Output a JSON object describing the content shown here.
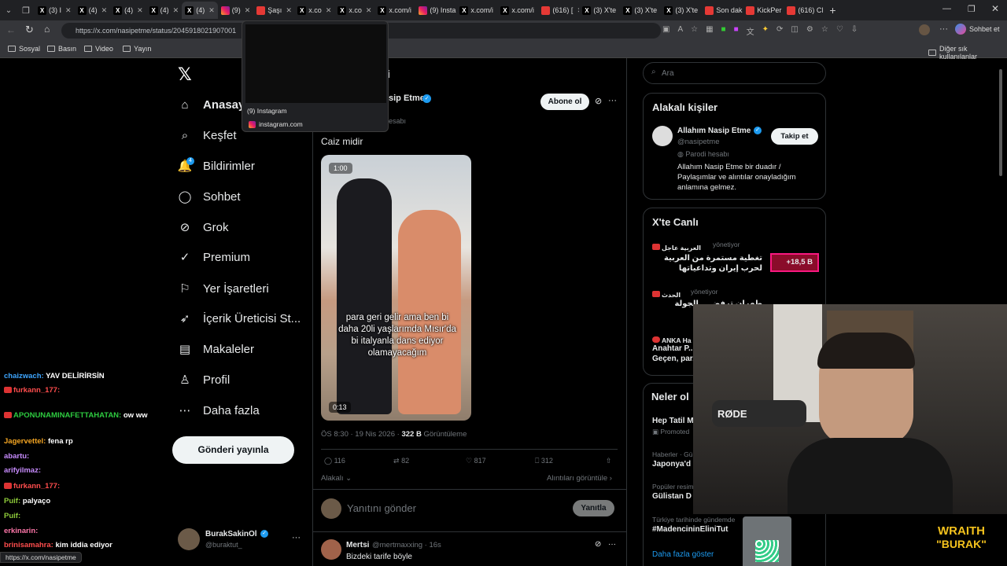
{
  "browser": {
    "tabs": [
      {
        "label": "(3) I",
        "fav": "x"
      },
      {
        "label": "(4)",
        "fav": "x"
      },
      {
        "label": "(4)",
        "fav": "x"
      },
      {
        "label": "(4)",
        "fav": "x"
      },
      {
        "label": "(4)",
        "fav": "x",
        "active": true
      },
      {
        "label": "(9)",
        "fav": "ig"
      },
      {
        "label": "Şaşı",
        "fav": "red"
      },
      {
        "label": "x.co",
        "fav": "x"
      },
      {
        "label": "x.co",
        "fav": "x"
      },
      {
        "label": "x.com/i",
        "fav": "x"
      },
      {
        "label": "(9) Insta",
        "fav": "ig"
      },
      {
        "label": "x.com/i",
        "fav": "x"
      },
      {
        "label": "x.com/i",
        "fav": "x"
      },
      {
        "label": "(616) [",
        "fav": "yt"
      },
      {
        "label": "(3) X'te",
        "fav": "x"
      },
      {
        "label": "(3) X'te",
        "fav": "x"
      },
      {
        "label": "(3) X'te",
        "fav": "x"
      },
      {
        "label": "Son dak",
        "fav": "red"
      },
      {
        "label": "KickPer",
        "fav": "red"
      },
      {
        "label": "(616) Cl",
        "fav": "yt"
      }
    ],
    "url": "https://x.com/nasipetme/status/2045918021907001",
    "chat_button": "Sohbet et",
    "bookmarks": [
      "Sosyal",
      "Basın",
      "Video",
      "Yayın"
    ],
    "bookmarks_right": "Diğer sık kullanılanlar",
    "tab_preview": {
      "title": "(9) Instagram",
      "domain": "instagram.com"
    },
    "status_url": "https://x.com/nasipetme"
  },
  "sidebar": {
    "items": [
      {
        "label": "Anasayfa",
        "icon": "home-icon"
      },
      {
        "label": "Keşfet",
        "icon": "search-icon"
      },
      {
        "label": "Bildirimler",
        "icon": "bell-icon"
      },
      {
        "label": "Sohbet",
        "icon": "chat-icon"
      },
      {
        "label": "Grok",
        "icon": "grok-icon"
      },
      {
        "label": "Premium",
        "icon": "verified-icon"
      },
      {
        "label": "Yer İşaretleri",
        "icon": "bookmark-icon"
      },
      {
        "label": "İçerik Üreticisi St...",
        "icon": "rocket-icon"
      },
      {
        "label": "Makaleler",
        "icon": "article-icon"
      },
      {
        "label": "Profil",
        "icon": "user-icon"
      },
      {
        "label": "Daha fazla",
        "icon": "more-icon"
      }
    ],
    "notif_count": "4",
    "post_button": "Gönderi yayınla",
    "account": {
      "name": "BurakSakinOl",
      "handle": "@buraktut_"
    }
  },
  "post": {
    "header": "i",
    "author": "sip Etme",
    "handle_hint": "esabı",
    "subscribe": "Abone ol",
    "text": "Caiz midir",
    "video": {
      "badge": "1:00",
      "caption": "para geri gelir ama ben bi daha 20li yaşlarımda Mısır'da bi italyanla dans ediyor olamayacağım",
      "time": "0:13"
    },
    "meta_time": "ÖS 8:30 · 19 Nis 2026 · ",
    "views": "322 B",
    "views_label": " Görüntüleme",
    "stats": {
      "replies": "116",
      "reposts": "82",
      "likes": "817",
      "bookmarks": "312"
    },
    "relevant": "Alakalı",
    "quotes": "Alıntıları görüntüle",
    "reply_placeholder": "Yanıtını gönder",
    "reply_button": "Yanıtla",
    "reply": {
      "name": "Mertsi",
      "handle": "@mertmaxxing · 16s",
      "text": "Bizdeki tarife böyle"
    }
  },
  "right": {
    "search_placeholder": "Ara",
    "people_title": "Alakalı kişiler",
    "person": {
      "name": "Allahım Nasip Etme",
      "handle": "@nasipetme",
      "parody": "Parodi hesabı",
      "bio": "Allahım Nasip Etme bir duadır / Paylaşımlar ve alıntılar onayladığım anlamına gelmez.",
      "follow": "Takip et"
    },
    "live_title": "X'te Canlı",
    "live": [
      {
        "source": "العربية عاجل",
        "status": "yönetiyor",
        "text": "تغطية مستمرة من العربية لحرب إيران وتداعياتها",
        "count": "+18,5 B"
      },
      {
        "source": "الحدث",
        "status": "yönetiyor",
        "text": "طهران ترفض ... الجولة الثانية من",
        "count": ""
      },
      {
        "source": "ANKA Ha",
        "status": "",
        "text": "Anahtar P... Geçen, par...",
        "count": ""
      }
    ],
    "trends_title": "Neler ol",
    "trends": [
      {
        "context": "",
        "title": "Hep Tatil M",
        "sub": "Promoted"
      },
      {
        "context": "Haberler · Gü",
        "title": "Japonya'd",
        "sub": ""
      },
      {
        "context": "Popüler resim",
        "title": "Gülistan D",
        "sub": ""
      },
      {
        "context": "Türkiye tarihinde gündemde",
        "title": "#MadencininEliniTut",
        "sub": ""
      }
    ],
    "show_more": "Daha fazla göster"
  },
  "chat": [
    {
      "user": "chaizwach",
      "msg": "YAV DELİRİRSİN",
      "color": "#3ea6ff",
      "badge": false
    },
    {
      "user": "furkann_177",
      "msg": "",
      "color": "#ff4d4d",
      "badge": true
    },
    {
      "user": "APONUNAMINAFETTAHATAN",
      "msg": "ow ww",
      "color": "#2ecc40",
      "badge": true
    },
    {
      "user": "Jagervettel",
      "msg": "fena rp",
      "color": "#f5a623",
      "badge": false
    },
    {
      "user": "abartu",
      "msg": "",
      "color": "#c88cff",
      "badge": false
    },
    {
      "user": "arifyilmaz",
      "msg": "",
      "color": "#c88cff",
      "badge": false
    },
    {
      "user": "furkann_177",
      "msg": "",
      "color": "#ff4d4d",
      "badge": true
    },
    {
      "user": "Puif",
      "msg": "palyaço",
      "color": "#8ecb3a",
      "badge": false
    },
    {
      "user": "Puif",
      "msg": "",
      "color": "#8ecb3a",
      "badge": false
    },
    {
      "user": "erkinarin",
      "msg": "",
      "color": "#ff77aa",
      "badge": false
    },
    {
      "user": "brinisamahra",
      "msg": "kim iddia ediyor",
      "color": "#ff4d4d",
      "badge": false
    },
    {
      "user": "bunu",
      "msg": "",
      "color": "#ffffff",
      "badge": false
    }
  ],
  "overlay": {
    "line1": "WRAITH",
    "line2": "\"BURAK\"",
    "mic_brand": "RØDE"
  }
}
